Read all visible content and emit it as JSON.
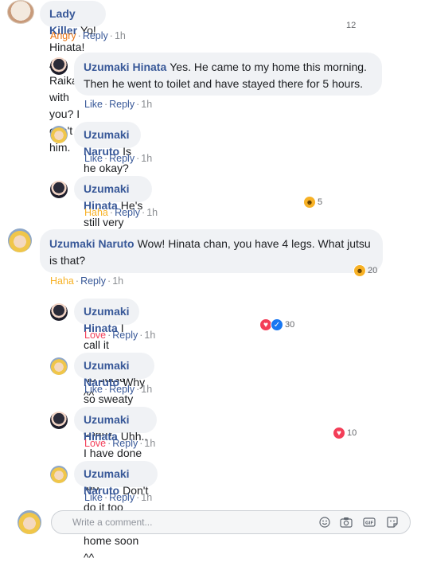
{
  "comments": [
    {
      "author": "Lady Killer",
      "text": "Yo! Hinata! Are Raikage with you? I can't call him.",
      "reaction_label": "Angry",
      "reply_label": "Reply",
      "time": "1h",
      "reaction_count": "12"
    },
    {
      "author": "Uzumaki Hinata",
      "text": "Yes. He came to my home this morning. Then he went to toilet and have stayed there for 5 hours.",
      "reaction_label": "Like",
      "reply_label": "Reply",
      "time": "1h"
    },
    {
      "author": "Uzumaki Naruto",
      "text": "Is he okay?",
      "reaction_label": "Like",
      "reply_label": "Reply",
      "time": "1h"
    },
    {
      "author": "Uzumaki Hinata",
      "text": "He's still very strong for sure ^^",
      "reaction_label": "Haha",
      "reply_label": "Reply",
      "time": "1h",
      "reaction_count": "5"
    },
    {
      "author": "Uzumaki Naruto",
      "text": "Wow! Hinata chan, you have 4 legs. What jutsu is that?",
      "reaction_label": "Haha",
      "reply_label": "Reply",
      "time": "1h",
      "reaction_count": "20"
    },
    {
      "author": "Uzumaki Hinata",
      "text": "I call it Riding no Jutsu ^^",
      "reaction_label": "Love",
      "reply_label": "Reply",
      "time": "1h",
      "reaction_count": "30"
    },
    {
      "author": "Uzumaki Naruto",
      "text": "Why so sweaty Hinata chan?",
      "reaction_label": "Like",
      "reply_label": "Reply",
      "time": "1h"
    },
    {
      "author": "Uzumaki Hinata",
      "text": "Uhh.. I have done some squad, too ^^",
      "reaction_label": "Love",
      "reply_label": "Reply",
      "time": "1h",
      "reaction_count": "10"
    },
    {
      "author": "Uzumaki Naruto",
      "text": "Don't do it too hard. I'll be home soon ^^",
      "reaction_label": "Like",
      "reply_label": "Reply",
      "time": "1h"
    }
  ],
  "composer": {
    "placeholder": "Write a comment..."
  },
  "colors": {
    "author": "#385898",
    "bubble": "#f0f2f5",
    "angry": "#e9710f",
    "haha": "#f7b125",
    "love": "#f33e58"
  }
}
